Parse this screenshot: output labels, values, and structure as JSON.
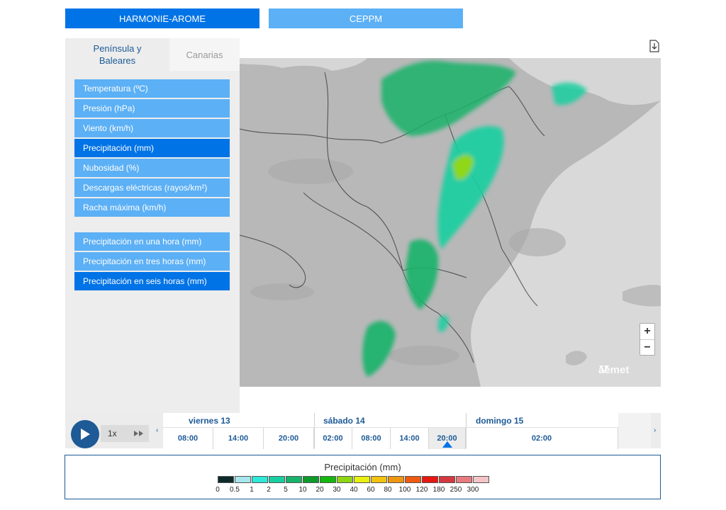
{
  "model_tabs": [
    {
      "label": "HARMONIE-AROME",
      "active": true
    },
    {
      "label": "CEPPM",
      "active": false
    }
  ],
  "region_tabs": [
    {
      "label": "Península y Baleares",
      "active": true
    },
    {
      "label": "Canarias",
      "active": false
    }
  ],
  "variables": [
    {
      "label": "Temperatura (ºC)",
      "active": false
    },
    {
      "label": "Presión (hPa)",
      "active": false
    },
    {
      "label": "Viento (km/h)",
      "active": false
    },
    {
      "label": "Precipitación (mm)",
      "active": true
    },
    {
      "label": "Nubosidad (%)",
      "active": false
    },
    {
      "label": "Descargas eléctricas (rayos/km²)",
      "active": false
    },
    {
      "label": "Racha máxima (km/h)",
      "active": false
    }
  ],
  "accumulations": [
    {
      "label": "Precipitación en una hora (mm)",
      "active": false
    },
    {
      "label": "Precipitación en tres horas (mm)",
      "active": false
    },
    {
      "label": "Precipitación en seis horas (mm)",
      "active": true
    }
  ],
  "map": {
    "zoom_in": "+",
    "zoom_out": "−",
    "logo": "aemet"
  },
  "player": {
    "speed": "1x",
    "prev": "‹",
    "next": "›"
  },
  "timeline": {
    "days": [
      {
        "label": "viernes 13",
        "hours": [
          "08:00",
          "14:00",
          "20:00"
        ]
      },
      {
        "label": "sábado 14",
        "hours": [
          "02:00",
          "08:00",
          "14:00",
          "20:00"
        ]
      },
      {
        "label": "domingo 15",
        "hours": [
          "02:00"
        ]
      }
    ],
    "selected_hour": "20:00",
    "selected_day": "sábado 14"
  },
  "legend": {
    "title": "Precipitación (mm)",
    "colors": [
      "#0d2a2a",
      "#a6e6ec",
      "#2ee8d8",
      "#19cfa0",
      "#18b36a",
      "#0e9a2a",
      "#13b80e",
      "#8ed613",
      "#e8f00f",
      "#f3c20e",
      "#ef9610",
      "#ef5a10",
      "#e8170f",
      "#d6383f",
      "#e77b80",
      "#f5c4c7"
    ],
    "labels": [
      "0",
      "0.5",
      "1",
      "2",
      "5",
      "10",
      "20",
      "30",
      "40",
      "60",
      "80",
      "100",
      "120",
      "180",
      "250",
      "300"
    ]
  }
}
